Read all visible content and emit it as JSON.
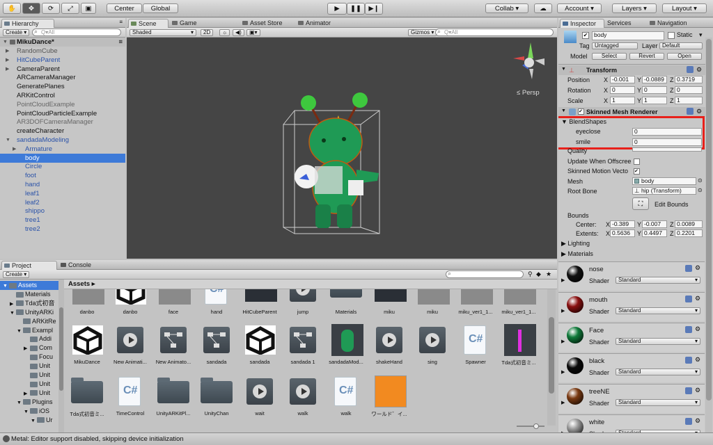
{
  "toolbar": {
    "tools": [
      "hand",
      "move",
      "rotate",
      "scale",
      "rect"
    ],
    "pivot": "Center",
    "space": "Global",
    "collab": "Collab ▾",
    "account": "Account",
    "layers": "Layers",
    "layout": "Layout"
  },
  "hierarchy": {
    "tab": "Hierarchy",
    "create": "Create ▾",
    "search": "Q▾All",
    "scene": "MikuDance*",
    "items": [
      {
        "label": "RandomCube",
        "indent": 1,
        "color": "#555",
        "arrow": "▶"
      },
      {
        "label": "HitCubeParent",
        "indent": 1,
        "color": "#2a52a8",
        "arrow": "▶"
      },
      {
        "label": "CameraParent",
        "indent": 1,
        "color": "#111",
        "arrow": "▶"
      },
      {
        "label": "ARCameraManager",
        "indent": 1,
        "color": "#111",
        "arrow": ""
      },
      {
        "label": "GeneratePlanes",
        "indent": 1,
        "color": "#111",
        "arrow": ""
      },
      {
        "label": "ARKitControl",
        "indent": 1,
        "color": "#111",
        "arrow": ""
      },
      {
        "label": "PointCloudExample",
        "indent": 1,
        "color": "#666",
        "arrow": ""
      },
      {
        "label": "PointCloudParticleExample",
        "indent": 1,
        "color": "#111",
        "arrow": ""
      },
      {
        "label": "AR3DOFCameraManager",
        "indent": 1,
        "color": "#666",
        "arrow": ""
      },
      {
        "label": "createCharacter",
        "indent": 1,
        "color": "#111",
        "arrow": ""
      },
      {
        "label": "sandadaModeling",
        "indent": 1,
        "color": "#2a52a8",
        "arrow": "▼"
      },
      {
        "label": "Armature",
        "indent": 2,
        "color": "#2a52a8",
        "arrow": "▶"
      },
      {
        "label": "body",
        "indent": 2,
        "color": "#2a52a8",
        "arrow": "",
        "selected": true
      },
      {
        "label": "Circle",
        "indent": 2,
        "color": "#2a52a8",
        "arrow": ""
      },
      {
        "label": "foot",
        "indent": 2,
        "color": "#2a52a8",
        "arrow": ""
      },
      {
        "label": "hand",
        "indent": 2,
        "color": "#2a52a8",
        "arrow": ""
      },
      {
        "label": "leaf1",
        "indent": 2,
        "color": "#2a52a8",
        "arrow": ""
      },
      {
        "label": "leaf2",
        "indent": 2,
        "color": "#2a52a8",
        "arrow": ""
      },
      {
        "label": "shippo",
        "indent": 2,
        "color": "#2a52a8",
        "arrow": ""
      },
      {
        "label": "tree1",
        "indent": 2,
        "color": "#2a52a8",
        "arrow": ""
      },
      {
        "label": "tree2",
        "indent": 2,
        "color": "#2a52a8",
        "arrow": ""
      }
    ]
  },
  "scene": {
    "tabs": [
      "Scene",
      "Game",
      "Asset Store",
      "Animator"
    ],
    "shading": "Shaded",
    "mode2d": "2D",
    "gizmos": "Gizmos ▾",
    "search": "Q▾All",
    "persp": "≤ Persp"
  },
  "inspector": {
    "tabs": [
      "Inspector",
      "Services",
      "Navigation"
    ],
    "object_name": "body",
    "static_label": "Static",
    "tag_label": "Tag",
    "tag_value": "Untagged",
    "layer_label": "Layer",
    "layer_value": "Default",
    "model_label": "Model",
    "model_buttons": [
      "Select",
      "Revert",
      "Open"
    ],
    "transform": {
      "title": "Transform",
      "rows": [
        {
          "label": "Position",
          "x": "-0.001",
          "y": "-0.0889",
          "z": "0.3719"
        },
        {
          "label": "Rotation",
          "x": "0",
          "y": "0",
          "z": "0"
        },
        {
          "label": "Scale",
          "x": "1",
          "y": "1",
          "z": "1"
        }
      ]
    },
    "smr": {
      "title": "Skinned Mesh Renderer",
      "blendshapes": "BlendShapes",
      "shapes": [
        {
          "label": "eyeclose",
          "value": "0"
        },
        {
          "label": "smile",
          "value": "0"
        }
      ],
      "quality": "Quality",
      "update": "Update When Offscree",
      "skinned": "Skinned Motion Vecto",
      "mesh_label": "Mesh",
      "mesh_value": "body",
      "rootbone_label": "Root Bone",
      "rootbone_value": "hip (Transform)",
      "edit_bounds": "Edit Bounds",
      "bounds": "Bounds",
      "center_label": "Center:",
      "center": {
        "x": "-0.389",
        "y": "-0.007",
        "z": "0.0089"
      },
      "extents_label": "Extents:",
      "extents": {
        "x": "0.5636",
        "y": "0.4497",
        "z": "0.2201"
      },
      "lighting": "Lighting",
      "materials": "Materials"
    },
    "mats": [
      {
        "name": "nose",
        "color": "#111111"
      },
      {
        "name": "mouth",
        "color": "#8a1010"
      },
      {
        "name": "Face",
        "color": "#0f7a3a"
      },
      {
        "name": "black",
        "color": "#0a0a0a"
      },
      {
        "name": "treeNE",
        "color": "#7a3a12"
      },
      {
        "name": "white",
        "color": "#9a9a9a"
      }
    ],
    "shader_label": "Shader",
    "shader_value": "Standard"
  },
  "project": {
    "tabs": [
      "Project",
      "Console"
    ],
    "create": "Create ▾",
    "breadcrumb": "Assets ▸",
    "tree": [
      {
        "label": "Assets",
        "indent": 0,
        "arrow": "▼",
        "selected": true
      },
      {
        "label": "Materials",
        "indent": 1,
        "arrow": ""
      },
      {
        "label": "Tda式初音",
        "indent": 1,
        "arrow": "▶"
      },
      {
        "label": "UnityARKi",
        "indent": 1,
        "arrow": "▼"
      },
      {
        "label": "ARKitRe",
        "indent": 2,
        "arrow": ""
      },
      {
        "label": "Exampl",
        "indent": 2,
        "arrow": "▼"
      },
      {
        "label": "Addi",
        "indent": 3,
        "arrow": ""
      },
      {
        "label": "Com",
        "indent": 3,
        "arrow": "▶"
      },
      {
        "label": "Focu",
        "indent": 3,
        "arrow": ""
      },
      {
        "label": "Unit",
        "indent": 3,
        "arrow": ""
      },
      {
        "label": "Unit",
        "indent": 3,
        "arrow": ""
      },
      {
        "label": "Unit",
        "indent": 3,
        "arrow": ""
      },
      {
        "label": "Unit",
        "indent": 3,
        "arrow": "▶"
      },
      {
        "label": "Plugins",
        "indent": 2,
        "arrow": "▼"
      },
      {
        "label": "iOS",
        "indent": 3,
        "arrow": "▼"
      },
      {
        "label": "Ur",
        "indent": 4,
        "arrow": "▼"
      }
    ],
    "row1": [
      "danbo",
      "danbo",
      "face",
      "hand",
      "HitCubeParent",
      "jump",
      "Materials",
      "miku",
      "miku",
      "miku_ver1_1...",
      "miku_ver1_1..."
    ],
    "row2": [
      "MikuDance",
      "New Animati...",
      "New Animato...",
      "sandada",
      "sandada",
      "sandada 1",
      "sandadaMod...",
      "shakeHand",
      "sing",
      "Spawner",
      "Tda式初音ミ..."
    ],
    "row3": [
      "Tda式初音ミ...",
      "TimeControl",
      "UnityARKitPl...",
      "UnityChan",
      "wait",
      "walk",
      "walk",
      "ワールド゛イ..."
    ]
  },
  "status": "Metal: Editor support disabled, skipping device initialization"
}
